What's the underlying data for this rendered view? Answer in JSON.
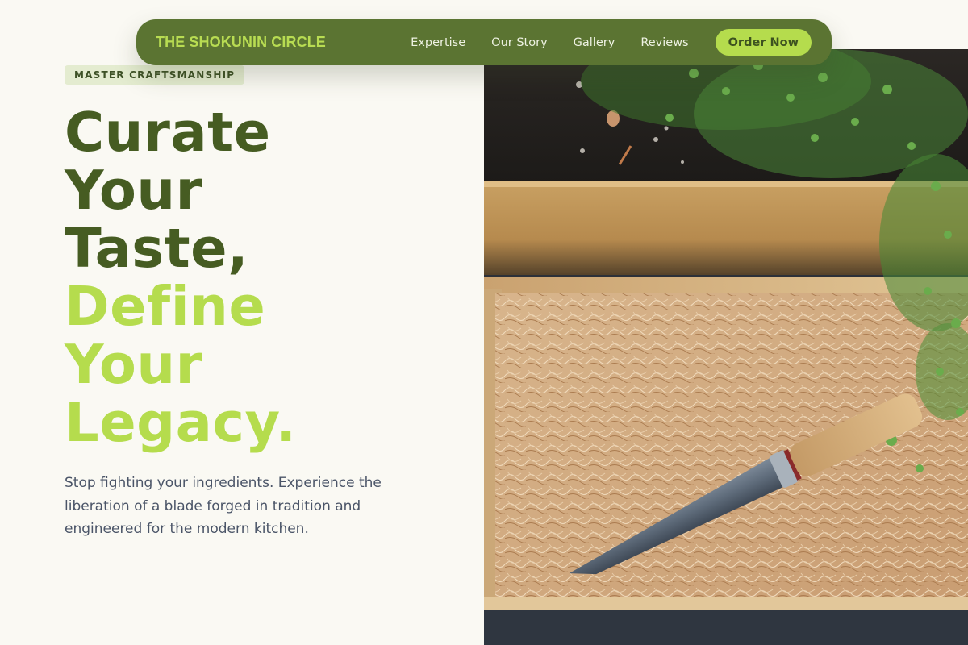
{
  "nav": {
    "brand": "THE SHOKUNIN CIRCLE",
    "links": [
      "Expertise",
      "Our Story",
      "Gallery",
      "Reviews"
    ],
    "cta": "Order Now"
  },
  "hero": {
    "badge": "MASTER CRAFTSMANSHIP",
    "headline_dark": [
      "Curate",
      "Your",
      "Taste,"
    ],
    "headline_accent": [
      "Define",
      "Your",
      "Legacy."
    ],
    "subtext": "Stop fighting your ingredients. Experience the liberation of a blade forged in tradition and engineered for the modern kitchen."
  },
  "image": {
    "subject": "kitchen knife resting on straw in a wooden box beside herbs"
  },
  "colors": {
    "nav_bg": "#5b7432",
    "brand": "#b8dc52",
    "accent": "#b5dc4d",
    "headline_dark": "#465c22",
    "body_text": "#4b5568",
    "page_bg": "#faf9f3"
  }
}
